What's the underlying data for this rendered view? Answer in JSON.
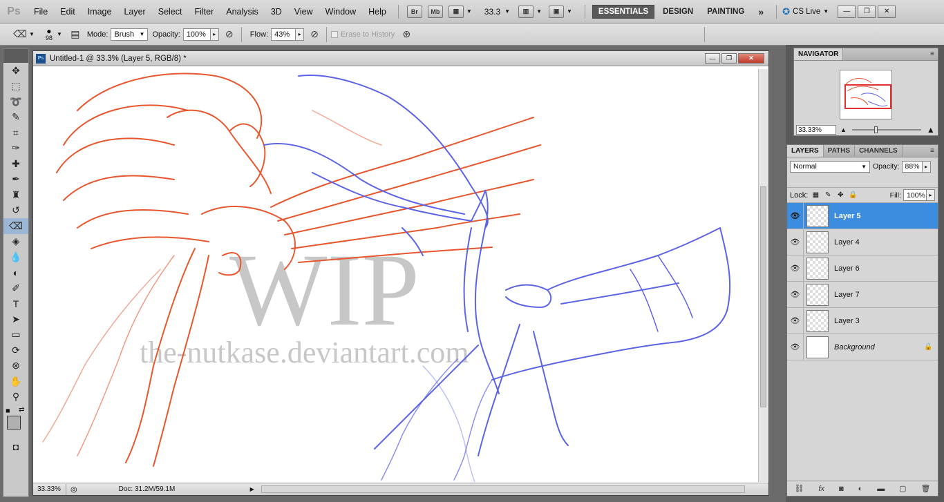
{
  "app": {
    "logo": "Ps",
    "menu": [
      "File",
      "Edit",
      "Image",
      "Layer",
      "Select",
      "Filter",
      "Analysis",
      "3D",
      "View",
      "Window",
      "Help"
    ],
    "bridge_label": "Br",
    "minibridge_label": "Mb",
    "zoom_value": "33.3",
    "workspaces": [
      "ESSENTIALS",
      "DESIGN",
      "PAINTING"
    ],
    "more_label": "»",
    "cslive_label": "CS Live"
  },
  "options": {
    "brush_size": "98",
    "mode_label": "Mode:",
    "mode_value": "Brush",
    "opacity_label": "Opacity:",
    "opacity_value": "100%",
    "flow_label": "Flow:",
    "flow_value": "43%",
    "erase_history_label": "Erase to History"
  },
  "document": {
    "title": "Untitled-1 @ 33.3% (Layer 5, RGB/8) *",
    "status_zoom": "33.33%",
    "status_doc": "Doc: 31.2M/59.1M",
    "watermark_big": "WIP",
    "watermark_small": "the-nutkase.deviantart.com"
  },
  "navigator": {
    "tab": "NAVIGATOR",
    "zoom": "33.33%"
  },
  "layers": {
    "tabs": [
      "LAYERS",
      "PATHS",
      "CHANNELS"
    ],
    "blend_mode": "Normal",
    "opacity_label": "Opacity:",
    "opacity_value": "88%",
    "lock_label": "Lock:",
    "fill_label": "Fill:",
    "fill_value": "100%",
    "items": [
      {
        "name": "Layer 5",
        "selected": true
      },
      {
        "name": "Layer 4",
        "selected": false
      },
      {
        "name": "Layer 6",
        "selected": false
      },
      {
        "name": "Layer 7",
        "selected": false
      },
      {
        "name": "Layer 3",
        "selected": false
      },
      {
        "name": "Background",
        "selected": false
      }
    ]
  },
  "colors": {
    "phoenix_stroke": "#e8562e",
    "dragon_stroke": "#5b63e6",
    "selection": "#3c8de0"
  }
}
